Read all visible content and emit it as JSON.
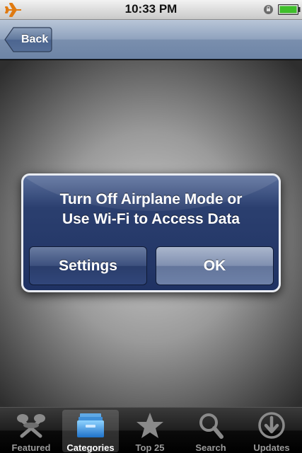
{
  "status_bar": {
    "time": "10:33 PM",
    "airplane_icon": "airplane-icon",
    "battery_icon": "battery-icon",
    "colors": {
      "airplane": "#e07a10",
      "battery": "#3fbf2a"
    }
  },
  "nav": {
    "back_label": "Back"
  },
  "alert": {
    "message_line1": "Turn Off Airplane Mode or",
    "message_line2": "Use Wi-Fi to Access Data",
    "settings_label": "Settings",
    "ok_label": "OK"
  },
  "tabs": [
    {
      "label": "Featured",
      "icon": "featured-icon",
      "active": false
    },
    {
      "label": "Categories",
      "icon": "categories-icon",
      "active": true
    },
    {
      "label": "Top 25",
      "icon": "star-icon",
      "active": false
    },
    {
      "label": "Search",
      "icon": "search-icon",
      "active": false
    },
    {
      "label": "Updates",
      "icon": "updates-icon",
      "active": false
    }
  ]
}
